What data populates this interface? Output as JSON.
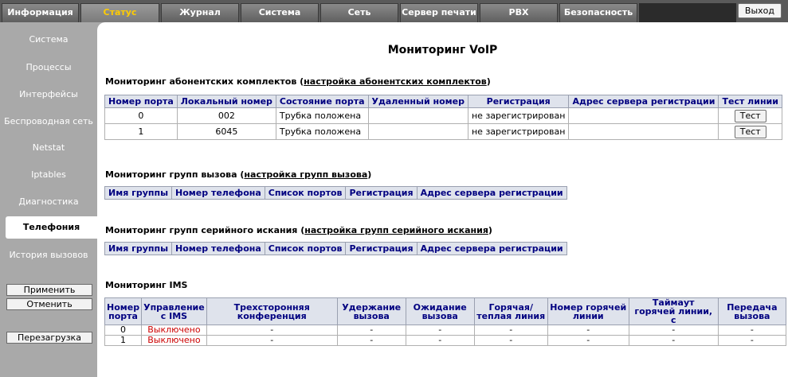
{
  "nav": {
    "tabs": [
      {
        "label": "Информация"
      },
      {
        "label": "Статус"
      },
      {
        "label": "Журнал"
      },
      {
        "label": "Система"
      },
      {
        "label": "Сеть"
      },
      {
        "label": "Сервер печати"
      },
      {
        "label": "PBX"
      },
      {
        "label": "Безопасность"
      }
    ],
    "active_tab": "Статус",
    "logout_label": "Выход"
  },
  "sidebar": {
    "items": [
      {
        "label": "Система"
      },
      {
        "label": "Процессы"
      },
      {
        "label": "Интерфейсы"
      },
      {
        "label": "Беспроводная сеть"
      },
      {
        "label": "Netstat"
      },
      {
        "label": "Iptables"
      },
      {
        "label": "Диагностика"
      },
      {
        "label": "Телефония"
      },
      {
        "label": "История вызовов"
      }
    ],
    "active_item": "Телефония",
    "apply_label": "Применить",
    "cancel_label": "Отменить",
    "reboot_label": "Перезагрузка"
  },
  "main": {
    "title": "Мониторинг VoIP",
    "subscriber": {
      "title_prefix": "Мониторинг абонентских комплектов (",
      "link": "настройка абонентских комплектов",
      "title_suffix": ")",
      "headers": [
        "Номер порта",
        "Локальный номер",
        "Состояние порта",
        "Удаленный номер",
        "Регистрация",
        "Адрес сервера регистрации",
        "Тест линии"
      ],
      "rows": [
        {
          "port": "0",
          "local": "002",
          "state": "Трубка положена",
          "remote": "",
          "reg": "не зарегистрирован",
          "server": "",
          "test": "Тест"
        },
        {
          "port": "1",
          "local": "6045",
          "state": "Трубка положена",
          "remote": "",
          "reg": "не зарегистрирован",
          "server": "",
          "test": "Тест"
        }
      ]
    },
    "call_groups": {
      "title_prefix": "Мониторинг групп вызова (",
      "link": "настройка групп вызова",
      "title_suffix": ")",
      "headers": [
        "Имя группы",
        "Номер телефона",
        "Список портов",
        "Регистрация",
        "Адрес сервера регистрации"
      ]
    },
    "hunt_groups": {
      "title_prefix": "Мониторинг групп серийного искания (",
      "link": "настройка групп серийного искания",
      "title_suffix": ")",
      "headers": [
        "Имя группы",
        "Номер телефона",
        "Список портов",
        "Регистрация",
        "Адрес сервера регистрации"
      ]
    },
    "ims": {
      "title": "Мониторинг IMS",
      "headers": [
        "Номер порта",
        "Управление с IMS",
        "Трехсторонняя конференция",
        "Удержание вызова",
        "Ожидание вызова",
        "Горячая/теплая линия",
        "Номер горячей линии",
        "Таймаут горячей линии, с",
        "Передача вызова"
      ],
      "rows": [
        [
          "0",
          "Выключено",
          "-",
          "-",
          "-",
          "-",
          "-",
          "-",
          "-"
        ],
        [
          "1",
          "Выключено",
          "-",
          "-",
          "-",
          "-",
          "-",
          "-",
          "-"
        ]
      ]
    }
  },
  "colors": {
    "active_tab_text": "#ffcc00",
    "header_text": "#000080",
    "disabled_text": "#cc0000"
  }
}
